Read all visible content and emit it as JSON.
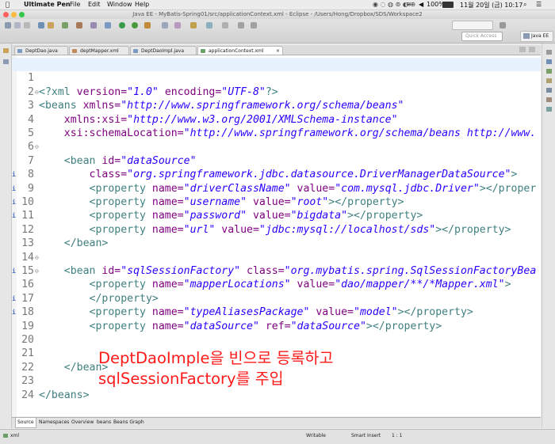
{
  "menubar": {
    "apple": "",
    "app_name": "Ultimate Pen",
    "menus": [
      "File",
      "Edit",
      "Window",
      "Help"
    ],
    "battery": "100%",
    "clock": "11월 20일 (금)  10:17"
  },
  "window": {
    "title": "Java EE - MyBatis-Spring01/src/applicationContext.xml - Eclipse - /Users/Hong/Dropbox/SDS/Workspace2"
  },
  "toolbar": {
    "quick_access_placeholder": "Quick Access",
    "perspective": "Java EE"
  },
  "editor_tabs": [
    {
      "label": "DeptDao.java",
      "active": false
    },
    {
      "label": "deptMapper.xml",
      "active": false
    },
    {
      "label": "DeptDaoImpl.java",
      "active": false
    },
    {
      "label": "applicationContext.xml",
      "active": true
    }
  ],
  "code_lines": [
    {
      "num": "1"
    },
    {
      "num": "2",
      "fold": "⊖"
    },
    {
      "num": "3"
    },
    {
      "num": "4"
    },
    {
      "num": "5"
    },
    {
      "num": "6",
      "fold": "⊖"
    },
    {
      "num": "7"
    },
    {
      "num": "8",
      "info": "i"
    },
    {
      "num": "9",
      "info": "i"
    },
    {
      "num": "10",
      "info": "i"
    },
    {
      "num": "11",
      "info": "i"
    },
    {
      "num": "12"
    },
    {
      "num": "13"
    },
    {
      "num": "14",
      "fold": "⊖"
    },
    {
      "num": "15",
      "fold": "⊖",
      "info": "i"
    },
    {
      "num": "16"
    },
    {
      "num": "17",
      "info": "i"
    },
    {
      "num": "18",
      "info": "i"
    },
    {
      "num": "19"
    },
    {
      "num": "20"
    },
    {
      "num": "21"
    },
    {
      "num": "22"
    },
    {
      "num": "23"
    },
    {
      "num": "24"
    }
  ],
  "code": {
    "l1": [
      "<?xml ",
      "version=",
      "\"1.0\"",
      " encoding=",
      "\"UTF-8\"",
      "?>"
    ],
    "l2": [
      "<beans ",
      "xmlns=",
      "\"http://www.springframework.org/schema/beans\""
    ],
    "l3": [
      "    xmlns:xsi=",
      "\"http://www.w3.org/2001/XMLSchema-instance\""
    ],
    "l4": [
      "    xsi:schemaLocation=",
      "\"http://www.springframework.org/schema/beans http://www."
    ],
    "l6": [
      "    <bean ",
      "id=",
      "\"dataSource\""
    ],
    "l7": [
      "        class=",
      "\"org.springframework.jdbc.datasource.DriverManagerDataSource\"",
      ">"
    ],
    "l8": [
      "        <property ",
      "name=",
      "\"driverClassName\"",
      " value=",
      "\"com.mysql.jdbc.Driver\"",
      "></proper"
    ],
    "l9": [
      "        <property ",
      "name=",
      "\"username\"",
      " value=",
      "\"root\"",
      "></property>"
    ],
    "l10": [
      "        <property ",
      "name=",
      "\"password\"",
      " value=",
      "\"bigdata\"",
      "></property>"
    ],
    "l11": [
      "        <property ",
      "name=",
      "\"url\"",
      " value=",
      "\"jdbc:mysql://localhost/sds\"",
      "></property>"
    ],
    "l12": [
      "    </bean>"
    ],
    "l14": [
      "    <bean ",
      "id=",
      "\"sqlSessionFactory\"",
      " class=",
      "\"org.mybatis.spring.SqlSessionFactoryBea"
    ],
    "l15": [
      "        <property ",
      "name=",
      "\"mapperLocations\"",
      " value=",
      "\"dao/mapper/**/*Mapper.xml\"",
      ">"
    ],
    "l16": [
      "        </property>"
    ],
    "l17": [
      "        <property ",
      "name=",
      "\"typeAliasesPackage\"",
      " value=",
      "\"model\"",
      "></property>"
    ],
    "l18": [
      "        <property ",
      "name=",
      "\"dataSource\"",
      " ref=",
      "\"dataSource\"",
      "></property>"
    ],
    "l21": [
      "    </bean>"
    ],
    "l23": [
      "</beans>"
    ]
  },
  "annotation": {
    "line1": "DeptDaoImple을 빈으로 등록하고",
    "line2": "sqlSessionFactory를 주입"
  },
  "bottom_tabs": [
    "Source",
    "Namespaces",
    "Overview",
    "beans",
    "Beans Graph"
  ],
  "status": {
    "element": "xml",
    "writable": "Writable",
    "insert_mode": "Smart Insert",
    "position": "1 : 1"
  },
  "colors": {
    "tag": "#3f7f7f",
    "attribute": "#7f007f",
    "value": "#2a00ff",
    "annotation": "#ff1a1a",
    "current_line": "#e8f2fe"
  }
}
